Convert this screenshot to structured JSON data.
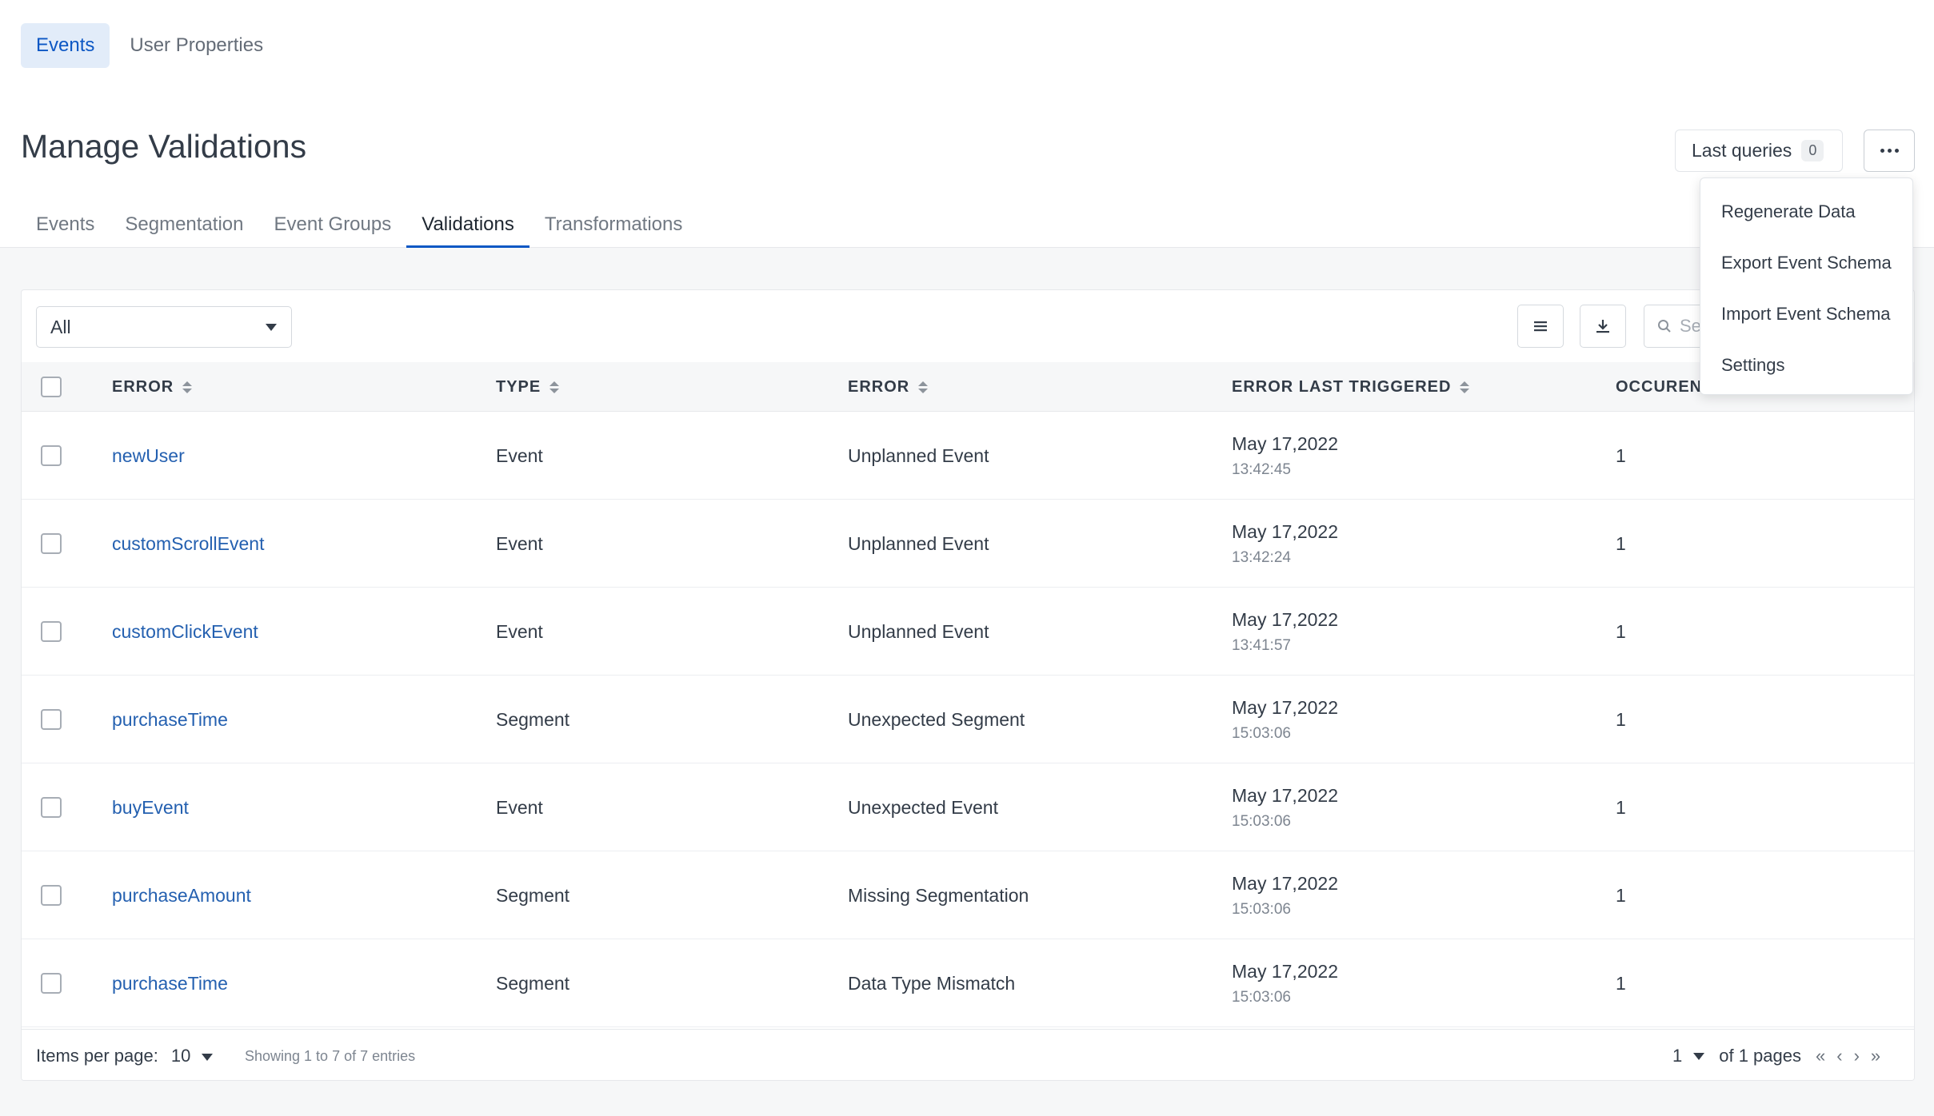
{
  "top_tabs": [
    {
      "label": "Events",
      "active": true
    },
    {
      "label": "User Properties",
      "active": false
    }
  ],
  "header": {
    "title": "Manage Validations",
    "last_queries_label": "Last queries",
    "last_queries_count": "0"
  },
  "sub_tabs": [
    {
      "label": "Events"
    },
    {
      "label": "Segmentation"
    },
    {
      "label": "Event Groups"
    },
    {
      "label": "Validations",
      "active": true
    },
    {
      "label": "Transformations"
    }
  ],
  "toolbar": {
    "filter_value": "All",
    "search_placeholder": "Se"
  },
  "table": {
    "columns": [
      "ERROR",
      "TYPE",
      "ERROR",
      "ERROR LAST TRIGGERED",
      "OCCURENC"
    ],
    "rows": [
      {
        "name": "newUser",
        "type": "Event",
        "error": "Unplanned Event",
        "date": "May 17,2022",
        "time": "13:42:45",
        "occurrences": "1"
      },
      {
        "name": "customScrollEvent",
        "type": "Event",
        "error": "Unplanned Event",
        "date": "May 17,2022",
        "time": "13:42:24",
        "occurrences": "1"
      },
      {
        "name": "customClickEvent",
        "type": "Event",
        "error": "Unplanned Event",
        "date": "May 17,2022",
        "time": "13:41:57",
        "occurrences": "1"
      },
      {
        "name": "purchaseTime",
        "type": "Segment",
        "error": "Unexpected Segment",
        "date": "May 17,2022",
        "time": "15:03:06",
        "occurrences": "1"
      },
      {
        "name": "buyEvent",
        "type": "Event",
        "error": "Unexpected Event",
        "date": "May 17,2022",
        "time": "15:03:06",
        "occurrences": "1"
      },
      {
        "name": "purchaseAmount",
        "type": "Segment",
        "error": "Missing Segmentation",
        "date": "May 17,2022",
        "time": "15:03:06",
        "occurrences": "1"
      },
      {
        "name": "purchaseTime",
        "type": "Segment",
        "error": "Data Type Mismatch",
        "date": "May 17,2022",
        "time": "15:03:06",
        "occurrences": "1"
      }
    ]
  },
  "footer": {
    "items_per_page_label": "Items per page:",
    "items_per_page_value": "10",
    "showing_text": "Showing 1 to 7 of 7 entries",
    "current_page": "1",
    "of_pages_text": "of 1 pages"
  },
  "dropdown_menu": {
    "items": [
      "Regenerate Data",
      "Export Event Schema",
      "Import Event Schema",
      "Settings"
    ]
  },
  "colors": {
    "accent": "#0c57c4",
    "active_tab_bg": "#e2ecf9",
    "link": "#2460b0"
  }
}
